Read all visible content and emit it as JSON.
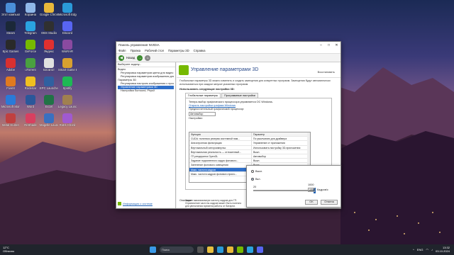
{
  "desktop": {
    "icons": [
      {
        "label": "Этот компьютер",
        "color": "#4a8fd8"
      },
      {
        "label": "Корзина",
        "color": "#8fb8e8"
      },
      {
        "label": "Google Chrome",
        "color": "#e8b83a"
      },
      {
        "label": "Microsoft Edge",
        "color": "#2a9ad8"
      },
      {
        "label": "Steam",
        "color": "#1b2838"
      },
      {
        "label": "Telegram",
        "color": "#2aa3e0"
      },
      {
        "label": "OBS Studio",
        "color": "#303030"
      },
      {
        "label": "Discord",
        "color": "#5865f2"
      },
      {
        "label": "Epic Games",
        "color": "#2a2a2a"
      },
      {
        "label": "GeForce",
        "color": "#76b900"
      },
      {
        "label": "Яндекс",
        "color": "#e03030"
      },
      {
        "label": "WinRAR",
        "color": "#8a4aa0"
      },
      {
        "label": "Adobe",
        "color": "#d83030"
      },
      {
        "label": "uTorrent",
        "color": "#4aa040"
      },
      {
        "label": "Блокнот",
        "color": "#e0e0e0"
      },
      {
        "label": "Smart Game Booster",
        "color": "#d8a030"
      },
      {
        "label": "FiveM",
        "color": "#e07a20"
      },
      {
        "label": "Rockstar",
        "color": "#f0c020"
      },
      {
        "label": "EPC Launcher",
        "color": "#3060a0"
      },
      {
        "label": "Spotify",
        "color": "#1db954"
      },
      {
        "label": "Microsoft Store",
        "color": "#2a7ad8"
      },
      {
        "label": "Word",
        "color": "#2b579a"
      },
      {
        "label": "Excel",
        "color": "#217346"
      },
      {
        "label": "Legacy Launcher",
        "color": "#a08050"
      },
      {
        "label": "Metal Hunter",
        "color": "#c04040"
      },
      {
        "label": "ReShade",
        "color": "#d84060"
      },
      {
        "label": "Magelle Launcher",
        "color": "#3a70c0"
      },
      {
        "label": "Rotrk Chord",
        "color": "#a05ad0"
      }
    ]
  },
  "window": {
    "title": "Панель управления NVIDIA",
    "menu": [
      "Файл",
      "Правка",
      "Рабочий стол",
      "Параметры 3D",
      "Справка"
    ],
    "toolbar": {
      "back": "Назад",
      "forward": "→"
    },
    "left_panel": {
      "header": "Выберите задачу...",
      "tree": [
        "Видео",
        "Регулировка параметров цвета для видео",
        "Регулировка параметров изображения для видео",
        "Параметры 3D",
        "Регулировка настроек изображения с просмотром",
        "Управление параметрами 3D",
        "Настройка Surround, PhysX"
      ],
      "selected_index": 5,
      "footer_link": "Информация о системе"
    },
    "page": {
      "title": "Управление параметрами 3D",
      "restore": "Восстановить",
      "description": "Глобальные параметры 3D можно изменить и создать замещения для конкретных программ. Замещения будут автоматически использоваться при каждом запуске указанных программ.",
      "section": "Использовать следующие настройки 3D:",
      "tabs": [
        "Глобальные параметры",
        "Программные настройки"
      ],
      "active_tab": 0,
      "info_line1": "Теперь выбор графического процессора управляется ОС Windows.",
      "info_link": "Открыть настройки графики Windows",
      "gpu_label": "Предпочтительный графический процессор:",
      "gpu_value": "Автовыбор",
      "settings_label": "Настройки:",
      "grid_header": [
        "Функция",
        "Параметр"
      ],
      "grid_rows": [
        [
          "CUDA: политика резерва системной пам...",
          "По умолчанию для драйвера"
        ],
        [
          "Анизотропная фильтрация",
          "Управление от приложения"
        ],
        [
          "Вертикальный синхроимпульс",
          "Использовать настройку 3D-приложения"
        ],
        [
          "Вертикальная реальность — отложенный...",
          "Выкл."
        ],
        [
          "ГП рендеринга OpenGL",
          "Автовыбор"
        ],
        [
          "Задание подчиненного кадра фонового...",
          "Выкл."
        ],
        [
          "Затенение фонового освещения",
          "Выкл."
        ],
        [
          "Макс. частота кадров",
          "1000 кадров/с"
        ],
        [
          "Макс. частота кадров фонового прило...",
          ""
        ]
      ],
      "highlight_row": 7,
      "desc_heading": "Описание.",
      "desc_text": "Задает максимальную частоту кадров для ГП. Ограничение частоты кадров может быть полезно для увеличения времени работы от батареи."
    }
  },
  "popup": {
    "option_off": "Выкл.",
    "option_on": "Вкл.",
    "selected": "on",
    "min": "20",
    "max": "1000",
    "value": "1000",
    "unit": "Кадров/с",
    "fill_fraction": 1.0,
    "ok": "OK",
    "cancel": "Отмена"
  },
  "taskbar": {
    "temperature": "12°C",
    "weather": "Облачно",
    "search": "Поиск",
    "lang": "ENG",
    "time": "13:32",
    "date": "03.10.2024"
  }
}
